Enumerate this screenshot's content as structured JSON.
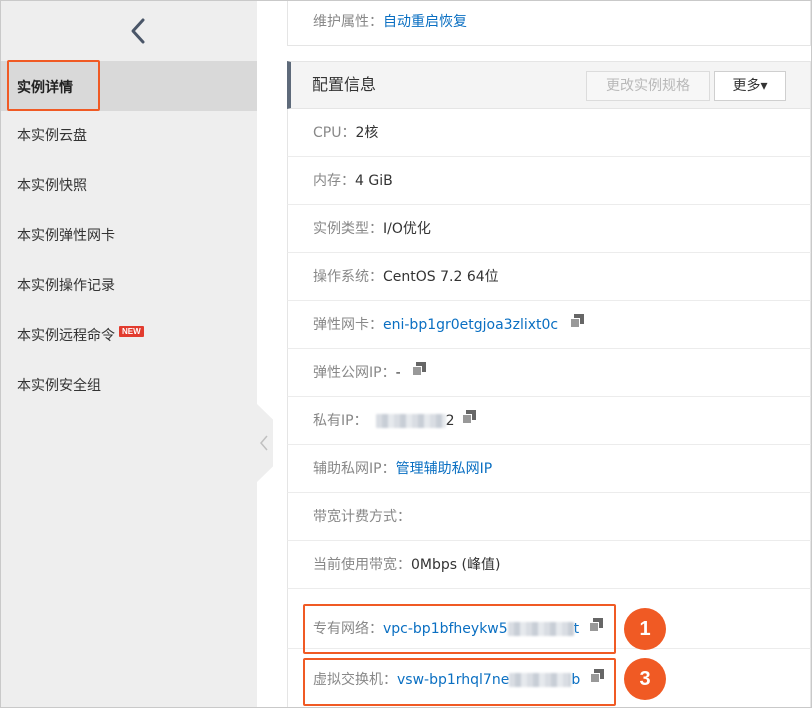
{
  "sidebar": {
    "back_label": "‹",
    "items": [
      {
        "label": "实例详情"
      },
      {
        "label": "本实例云盘"
      },
      {
        "label": "本实例快照"
      },
      {
        "label": "本实例弹性网卡"
      },
      {
        "label": "本实例操作记录"
      },
      {
        "label": "本实例远程命令",
        "badge": "NEW"
      },
      {
        "label": "本实例安全组"
      }
    ]
  },
  "top_row": {
    "label": "维护属性：",
    "value": "自动重启恢复"
  },
  "config": {
    "title": "配置信息",
    "modify_button": "更改实例规格",
    "more_button": "更多▾"
  },
  "rows": {
    "cpu": {
      "label": "CPU：",
      "value": "2核"
    },
    "memory": {
      "label": "内存：",
      "value": "4 GiB"
    },
    "instance_type": {
      "label": "实例类型：",
      "value": "I/O优化"
    },
    "os": {
      "label": "操作系统：",
      "value": "CentOS 7.2 64位"
    },
    "eni": {
      "label": "弹性网卡：",
      "value": "eni-bp1gr0etgjoa3zlixt0c"
    },
    "eip": {
      "label": "弹性公网IP：",
      "value": "-"
    },
    "private_ip": {
      "label": "私有IP：",
      "value_suffix": "2"
    },
    "secondary_ip": {
      "label": "辅助私网IP：",
      "value": "管理辅助私网IP"
    },
    "billing": {
      "label": "带宽计费方式："
    },
    "bandwidth": {
      "label": "当前使用带宽：",
      "value": "0Mbps (峰值)"
    },
    "vpc": {
      "label": "专有网络：",
      "value_prefix": "vpc-bp1bfheykw5",
      "value_suffix": "t"
    },
    "vswitch": {
      "label": "虚拟交换机：",
      "value_prefix": "vsw-bp1rhql7ne",
      "value_suffix": "b"
    }
  },
  "steps": {
    "first": "1",
    "second": "3"
  },
  "colors": {
    "highlight": "#f05a24",
    "link": "#0a6fc2",
    "sidebar_bg": "#eeeeee"
  }
}
